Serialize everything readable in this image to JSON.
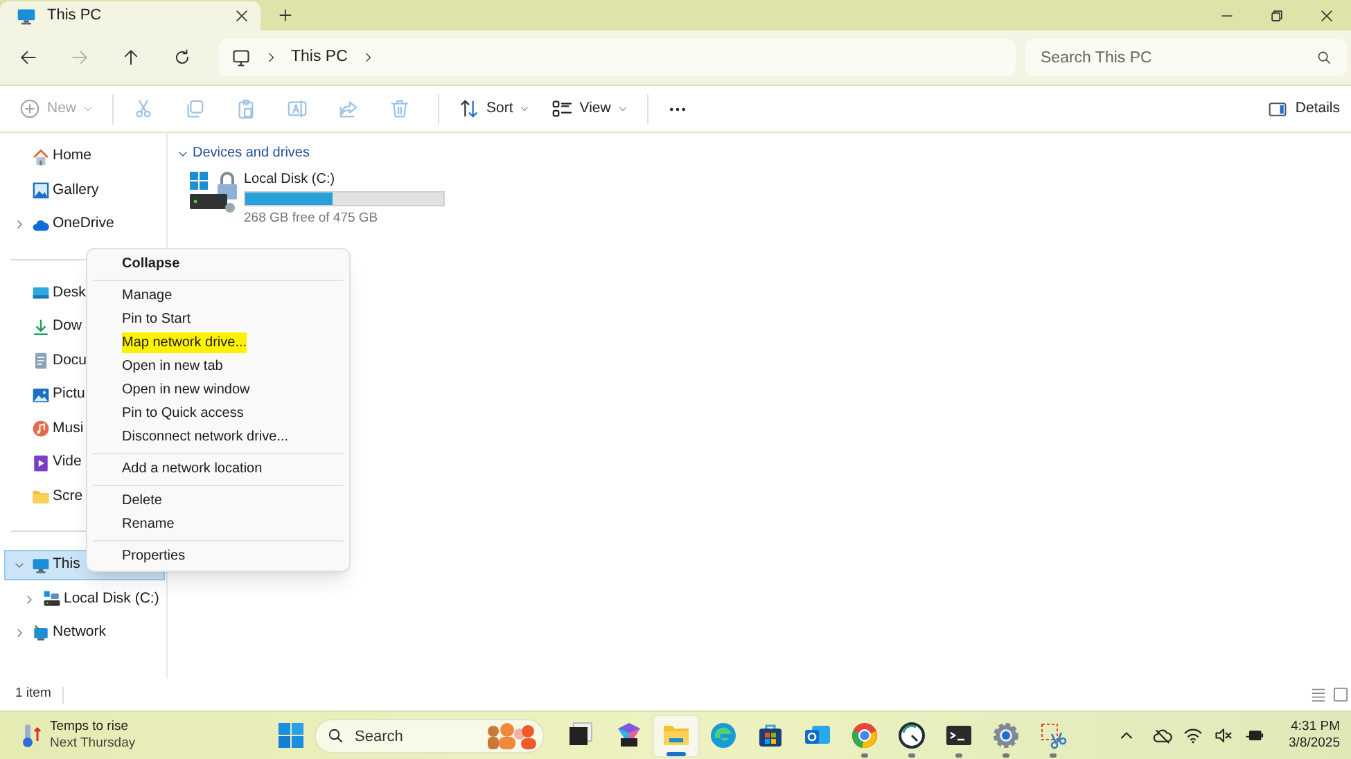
{
  "window": {
    "tab_title": "This PC"
  },
  "navigation": {
    "buttons": [
      {
        "disabled": false
      },
      {
        "disabled": true
      },
      {
        "disabled": false
      },
      {
        "disabled": false
      }
    ],
    "breadcrumb": [
      "This PC"
    ],
    "search": {
      "placeholder": "Search This PC"
    }
  },
  "toolbar": {
    "items": [
      {
        "label": "New",
        "disabled": true,
        "dropdown": true
      },
      {
        "disabled": true,
        "dropdown": false
      },
      {
        "disabled": true,
        "dropdown": false
      },
      {
        "disabled": true,
        "dropdown": false
      },
      {
        "disabled": true,
        "dropdown": false
      },
      {
        "disabled": true,
        "dropdown": false
      },
      {
        "disabled": true,
        "dropdown": false
      },
      {
        "label": "Sort",
        "disabled": false,
        "dropdown": true
      },
      {
        "label": "View",
        "disabled": false,
        "dropdown": true
      },
      {
        "disabled": false,
        "dropdown": false
      }
    ],
    "details": {
      "label": "Details"
    }
  },
  "sidebar": {
    "sections": [
      [
        {
          "label": "Home",
          "expandable": false,
          "selected": false
        },
        {
          "label": "Gallery",
          "expandable": false,
          "selected": false
        },
        {
          "label": "OneDrive",
          "expandable": true,
          "expanded": false,
          "selected": false
        }
      ],
      [
        {
          "label": "Desk",
          "expandable": false,
          "selected": false
        },
        {
          "label": "Dow",
          "expandable": false,
          "selected": false
        },
        {
          "label": "Docu",
          "expandable": false,
          "selected": false
        },
        {
          "label": "Pictu",
          "expandable": false,
          "selected": false
        },
        {
          "label": "Musi",
          "expandable": false,
          "selected": false
        },
        {
          "label": "Vide",
          "expandable": false,
          "selected": false
        },
        {
          "label": "Scre",
          "expandable": false,
          "selected": false
        }
      ],
      [
        {
          "label": "This",
          "expandable": true,
          "expanded": true,
          "selected": true,
          "children": [
            {
              "label": "Local Disk (C:)",
              "expandable": true,
              "expanded": false,
              "selected": false
            }
          ]
        },
        {
          "label": "Network",
          "expandable": true,
          "expanded": false,
          "selected": false
        }
      ]
    ]
  },
  "content": {
    "group": {
      "title": "Devices and drives",
      "expanded": true
    },
    "drives": [
      {
        "name": "Local Disk (C:)",
        "level": 0.44,
        "free": "268 GB free of 475 GB"
      }
    ]
  },
  "context_menu": {
    "sections": [
      [
        {
          "label": "Collapse",
          "default": true,
          "highlighted": false
        }
      ],
      [
        {
          "label": "Manage",
          "default": false,
          "highlighted": false
        },
        {
          "label": "Pin to Start",
          "default": false,
          "highlighted": false
        },
        {
          "label": "Map network drive...",
          "default": false,
          "highlighted": true
        },
        {
          "label": "Open in new tab",
          "default": false,
          "highlighted": false
        },
        {
          "label": "Open in new window",
          "default": false,
          "highlighted": false
        },
        {
          "label": "Pin to Quick access",
          "default": false,
          "highlighted": false
        },
        {
          "label": "Disconnect network drive...",
          "default": false,
          "highlighted": false
        }
      ],
      [
        {
          "label": "Add a network location",
          "default": false,
          "highlighted": false
        }
      ],
      [
        {
          "label": "Delete",
          "default": false,
          "highlighted": false
        },
        {
          "label": "Rename",
          "default": false,
          "highlighted": false
        }
      ],
      [
        {
          "label": "Properties",
          "default": false,
          "highlighted": false
        }
      ]
    ]
  },
  "status_bar": {
    "count": "1 item"
  },
  "taskbar": {
    "weather": {
      "title": "Temps to rise",
      "subtitle": "Next Thursday"
    },
    "search": {
      "placeholder": "Search"
    },
    "apps": [
      {
        "running": false,
        "active": false
      },
      {
        "running": false,
        "active": false
      },
      {
        "running": true,
        "active": true
      },
      {
        "running": false,
        "active": false
      },
      {
        "running": false,
        "active": false
      },
      {
        "running": false,
        "active": false
      },
      {
        "running": true,
        "active": false
      },
      {
        "running": true,
        "active": false
      },
      {
        "running": true,
        "active": false
      },
      {
        "running": true,
        "active": false
      },
      {
        "running": true,
        "active": false
      }
    ],
    "clock": {
      "time": "4:31 PM",
      "date": "3/8/2025"
    }
  }
}
